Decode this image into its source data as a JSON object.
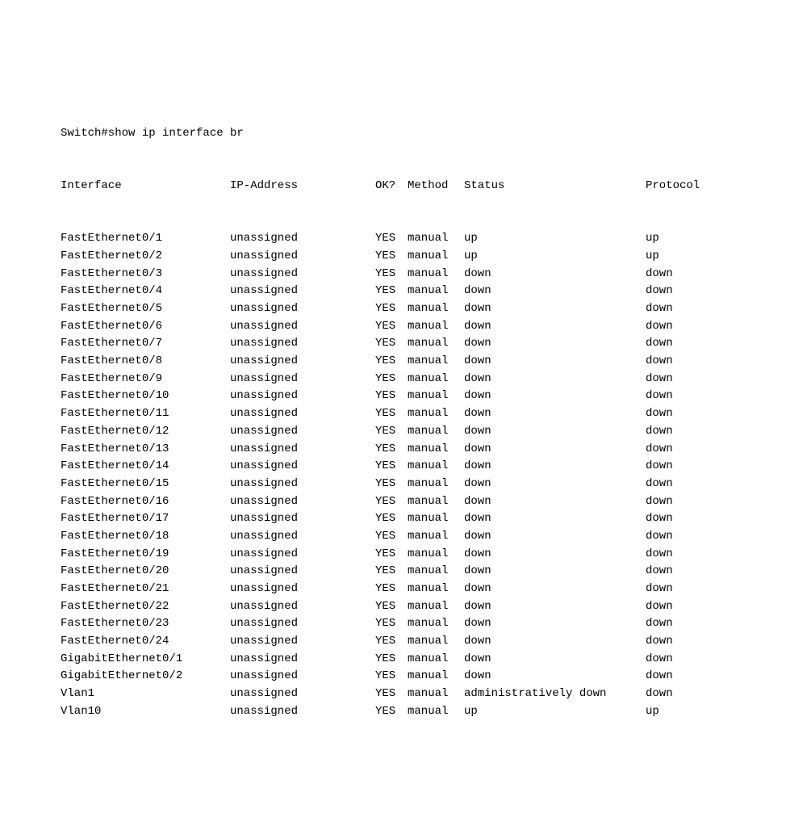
{
  "prompt": "Switch#show ip interface br",
  "header": {
    "interface": "Interface",
    "ip": "IP-Address",
    "ok": "OK?",
    "method": "Method",
    "status": "Status",
    "protocol": "Protocol"
  },
  "rows": [
    {
      "interface": "FastEthernet0/1",
      "ip": "unassigned",
      "ok": "YES",
      "method": "manual",
      "status": "up",
      "protocol": "up"
    },
    {
      "interface": "FastEthernet0/2",
      "ip": "unassigned",
      "ok": "YES",
      "method": "manual",
      "status": "up",
      "protocol": "up"
    },
    {
      "interface": "FastEthernet0/3",
      "ip": "unassigned",
      "ok": "YES",
      "method": "manual",
      "status": "down",
      "protocol": "down"
    },
    {
      "interface": "FastEthernet0/4",
      "ip": "unassigned",
      "ok": "YES",
      "method": "manual",
      "status": "down",
      "protocol": "down"
    },
    {
      "interface": "FastEthernet0/5",
      "ip": "unassigned",
      "ok": "YES",
      "method": "manual",
      "status": "down",
      "protocol": "down"
    },
    {
      "interface": "FastEthernet0/6",
      "ip": "unassigned",
      "ok": "YES",
      "method": "manual",
      "status": "down",
      "protocol": "down"
    },
    {
      "interface": "FastEthernet0/7",
      "ip": "unassigned",
      "ok": "YES",
      "method": "manual",
      "status": "down",
      "protocol": "down"
    },
    {
      "interface": "FastEthernet0/8",
      "ip": "unassigned",
      "ok": "YES",
      "method": "manual",
      "status": "down",
      "protocol": "down"
    },
    {
      "interface": "FastEthernet0/9",
      "ip": "unassigned",
      "ok": "YES",
      "method": "manual",
      "status": "down",
      "protocol": "down"
    },
    {
      "interface": "FastEthernet0/10",
      "ip": "unassigned",
      "ok": "YES",
      "method": "manual",
      "status": "down",
      "protocol": "down"
    },
    {
      "interface": "FastEthernet0/11",
      "ip": "unassigned",
      "ok": "YES",
      "method": "manual",
      "status": "down",
      "protocol": "down"
    },
    {
      "interface": "FastEthernet0/12",
      "ip": "unassigned",
      "ok": "YES",
      "method": "manual",
      "status": "down",
      "protocol": "down"
    },
    {
      "interface": "FastEthernet0/13",
      "ip": "unassigned",
      "ok": "YES",
      "method": "manual",
      "status": "down",
      "protocol": "down"
    },
    {
      "interface": "FastEthernet0/14",
      "ip": "unassigned",
      "ok": "YES",
      "method": "manual",
      "status": "down",
      "protocol": "down"
    },
    {
      "interface": "FastEthernet0/15",
      "ip": "unassigned",
      "ok": "YES",
      "method": "manual",
      "status": "down",
      "protocol": "down"
    },
    {
      "interface": "FastEthernet0/16",
      "ip": "unassigned",
      "ok": "YES",
      "method": "manual",
      "status": "down",
      "protocol": "down"
    },
    {
      "interface": "FastEthernet0/17",
      "ip": "unassigned",
      "ok": "YES",
      "method": "manual",
      "status": "down",
      "protocol": "down"
    },
    {
      "interface": "FastEthernet0/18",
      "ip": "unassigned",
      "ok": "YES",
      "method": "manual",
      "status": "down",
      "protocol": "down"
    },
    {
      "interface": "FastEthernet0/19",
      "ip": "unassigned",
      "ok": "YES",
      "method": "manual",
      "status": "down",
      "protocol": "down"
    },
    {
      "interface": "FastEthernet0/20",
      "ip": "unassigned",
      "ok": "YES",
      "method": "manual",
      "status": "down",
      "protocol": "down"
    },
    {
      "interface": "FastEthernet0/21",
      "ip": "unassigned",
      "ok": "YES",
      "method": "manual",
      "status": "down",
      "protocol": "down"
    },
    {
      "interface": "FastEthernet0/22",
      "ip": "unassigned",
      "ok": "YES",
      "method": "manual",
      "status": "down",
      "protocol": "down"
    },
    {
      "interface": "FastEthernet0/23",
      "ip": "unassigned",
      "ok": "YES",
      "method": "manual",
      "status": "down",
      "protocol": "down"
    },
    {
      "interface": "FastEthernet0/24",
      "ip": "unassigned",
      "ok": "YES",
      "method": "manual",
      "status": "down",
      "protocol": "down"
    },
    {
      "interface": "GigabitEthernet0/1",
      "ip": "unassigned",
      "ok": "YES",
      "method": "manual",
      "status": "down",
      "protocol": "down"
    },
    {
      "interface": "GigabitEthernet0/2",
      "ip": "unassigned",
      "ok": "YES",
      "method": "manual",
      "status": "down",
      "protocol": "down"
    },
    {
      "interface": "Vlan1",
      "ip": "unassigned",
      "ok": "YES",
      "method": "manual",
      "status": "administratively down",
      "protocol": "down"
    },
    {
      "interface": "Vlan10",
      "ip": "unassigned",
      "ok": "YES",
      "method": "manual",
      "status": "up",
      "protocol": "up"
    }
  ]
}
